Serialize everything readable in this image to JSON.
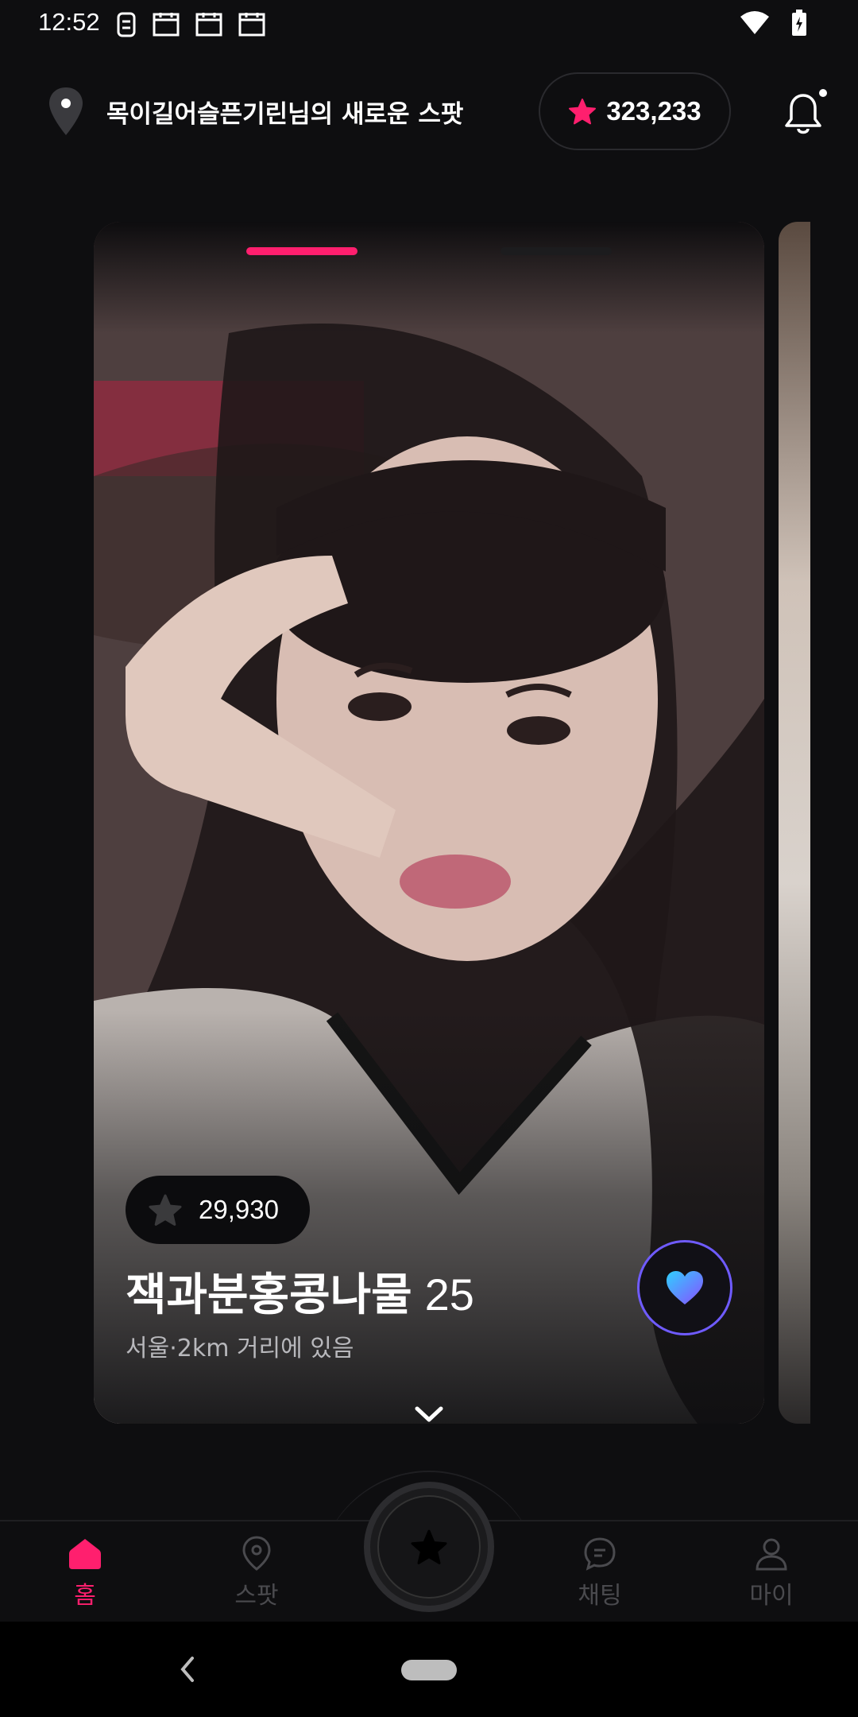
{
  "status_bar": {
    "time": "12:52"
  },
  "header": {
    "location_title": "목이길어슬픈기린님의 새로운 스팟",
    "points": "323,233"
  },
  "card": {
    "star_count": "29,930",
    "name": "잭과분홍콩나물",
    "age": "25",
    "distance": "서울·2km 거리에 있음"
  },
  "nav": {
    "items": [
      {
        "label": "홈"
      },
      {
        "label": "스팟"
      },
      {
        "label": "채팅"
      },
      {
        "label": "마이"
      }
    ]
  },
  "colors": {
    "accent": "#ff1f6e",
    "background": "#0e0e10",
    "like_ring": "#6f5bff"
  },
  "icons": [
    "location-pin-icon",
    "star-icon",
    "bell-icon",
    "heart-icon",
    "chevron-down-icon",
    "home-icon",
    "map-pin-icon",
    "chat-bubble-icon",
    "person-icon",
    "back-icon"
  ]
}
